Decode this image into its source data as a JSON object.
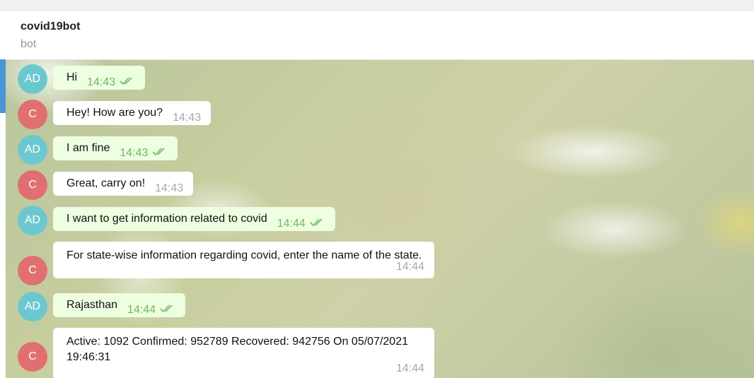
{
  "header": {
    "title": "covid19bot",
    "subtitle": "bot"
  },
  "colors": {
    "accent": "#4a95d6",
    "outgoing_bubble": "#eefee0",
    "incoming_bubble": "#ffffff",
    "avatar_user": "#6cc8cf",
    "avatar_bot": "#e16f72",
    "tick": "#6db866"
  },
  "messages": [
    {
      "sender": "AD",
      "text": "Hi",
      "time": "14:43",
      "status_icon": "double-check-icon"
    },
    {
      "sender": "C",
      "text": "Hey! How are you?",
      "time": "14:43"
    },
    {
      "sender": "AD",
      "text": "I am fine",
      "time": "14:43",
      "status_icon": "double-check-icon"
    },
    {
      "sender": "C",
      "text": "Great, carry on!",
      "time": "14:43"
    },
    {
      "sender": "AD",
      "text": "I want to get information related to covid",
      "time": "14:44",
      "status_icon": "double-check-icon"
    },
    {
      "sender": "C",
      "text": "For state-wise information regarding covid, enter the name of the state.",
      "time": "14:44"
    },
    {
      "sender": "AD",
      "text": "Rajasthan",
      "time": "14:44",
      "status_icon": "double-check-icon"
    },
    {
      "sender": "C",
      "text": "Active: 1092 Confirmed: 952789 Recovered: 942756 On 05/07/2021 19:46:31",
      "time": "14:44"
    }
  ]
}
